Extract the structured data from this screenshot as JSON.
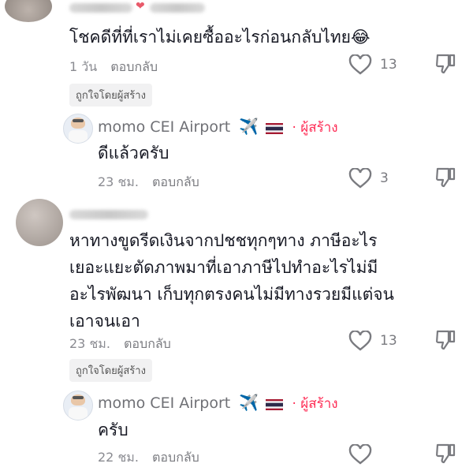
{
  "comments": [
    {
      "text": "โชคดีที่ที่เราไม่เคยซื้ออะไรก่อนกลับไทย😂",
      "time": "1 วัน",
      "reply": "ตอบกลับ",
      "likes": "13",
      "badge": "ถูกใจโดยผู้สร้าง",
      "author_reply": {
        "name": "momo  CEI Airport",
        "plane": "✈️",
        "creator": "· ผู้สร้าง",
        "text": "ดีแล้วครับ",
        "time": "23 ชม.",
        "reply": "ตอบกลับ",
        "likes": "3"
      }
    },
    {
      "text_lines": [
        "หาทางขูดรีดเงินจากปชชทุกๆทาง ภาษีอะไร",
        "เยอะแยะตัดภาพมาที่เอาภาษีไปทำอะไรไม่มี",
        "อะไรพัฒนา เก็บทุกตรงคนไม่มีทางรวยมีแต่จน",
        "เอาจนเอา"
      ],
      "time": "23 ชม.",
      "reply": "ตอบกลับ",
      "likes": "13",
      "badge": "ถูกใจโดยผู้สร้าง",
      "author_reply": {
        "name": "momo  CEI Airport",
        "plane": "✈️",
        "creator": "· ผู้สร้าง",
        "text": "ครับ",
        "time": "22 ชม.",
        "reply": "ตอบกลับ"
      }
    }
  ],
  "colors": {
    "creator_red": "#fe2c55",
    "meta_gray": "#8a8b91"
  }
}
